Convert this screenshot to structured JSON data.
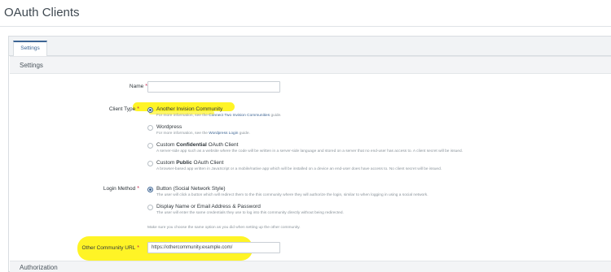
{
  "header": {
    "title": "OAuth Clients"
  },
  "tabs": [
    {
      "label": "Settings"
    }
  ],
  "sections": {
    "settings": "Settings",
    "authorization": "Authorization"
  },
  "form": {
    "name": {
      "label": "Name",
      "value": ""
    },
    "client_type": {
      "label": "Client Type",
      "options": [
        {
          "title": "Another Invision Community",
          "desc_pre": "For more information, see the ",
          "link": "Connect Two Invision Communities",
          "desc_post": " guide.",
          "checked": true
        },
        {
          "title": "Wordpress",
          "desc_pre": "For more information, see the ",
          "link": "Wordpress Login",
          "desc_post": " guide.",
          "checked": false
        },
        {
          "title_pre": "Custom ",
          "title_bold": "Confidential",
          "title_post": " OAuth Client",
          "desc": "A server-side app such as a website where the code will be written in a server-side language and stored on a server that no end-user has access to. A client secret will be issued.",
          "checked": false
        },
        {
          "title_pre": "Custom ",
          "title_bold": "Public",
          "title_post": " OAuth Client",
          "desc": "A browser-based app written in JavaScript or a mobile/native app which will be installed on a device an end-user does have access to. No client secret will be issued.",
          "checked": false
        }
      ]
    },
    "login_method": {
      "label": "Login Method",
      "options": [
        {
          "title": "Button (Social Network Style)",
          "desc": "The user will click a button which will redirect them to the this community where they will authorize the login, similar to when logging in using a social network.",
          "checked": true
        },
        {
          "title": "Display Name or Email Address & Password",
          "desc": "The user will enter the same credentials they use to log into this community directly without being redirected.",
          "checked": false
        }
      ],
      "note": "Make sure you choose the same option as you did when setting up the other community."
    },
    "other_url": {
      "label": "Other Community URL",
      "value": "https://othercommunity.example.com/"
    }
  },
  "required_mark": "*",
  "colors": {
    "accent": "#3d6594",
    "required": "#c7254e",
    "highlight": "#fff200"
  }
}
